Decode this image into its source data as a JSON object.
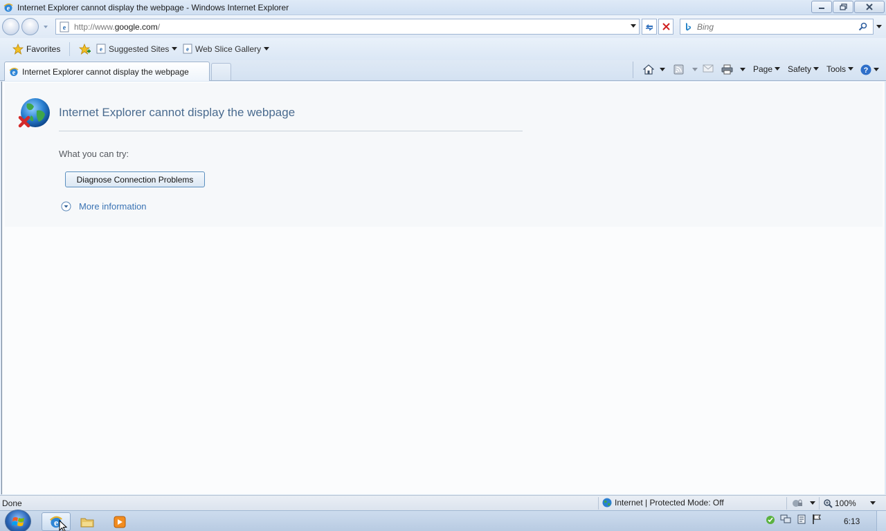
{
  "window": {
    "title": "Internet Explorer cannot display the webpage - Windows Internet Explorer"
  },
  "address": {
    "prefix": "http://www.",
    "host": "google.com",
    "suffix": "/"
  },
  "search": {
    "placeholder": "Bing"
  },
  "favorites_bar": {
    "favorites_label": "Favorites",
    "links": [
      {
        "label": "Suggested Sites"
      },
      {
        "label": "Web Slice Gallery"
      }
    ]
  },
  "tabs": [
    {
      "label": "Internet Explorer cannot display the webpage",
      "active": true
    }
  ],
  "command_bar": {
    "page_label": "Page",
    "safety_label": "Safety",
    "tools_label": "Tools"
  },
  "error_page": {
    "title": "Internet Explorer cannot display the webpage",
    "what_you_can_try": "What you can try:",
    "diagnose_button": "Diagnose Connection Problems",
    "more_information": "More information"
  },
  "status_bar": {
    "status": "Done",
    "zone": "Internet | Protected Mode: Off",
    "zoom": "100%"
  },
  "taskbar": {
    "clock": "6:13"
  },
  "colors": {
    "error_title": "#4a6b8f",
    "link": "#3a73b4",
    "accent_button_border": "#5a8fbf"
  }
}
